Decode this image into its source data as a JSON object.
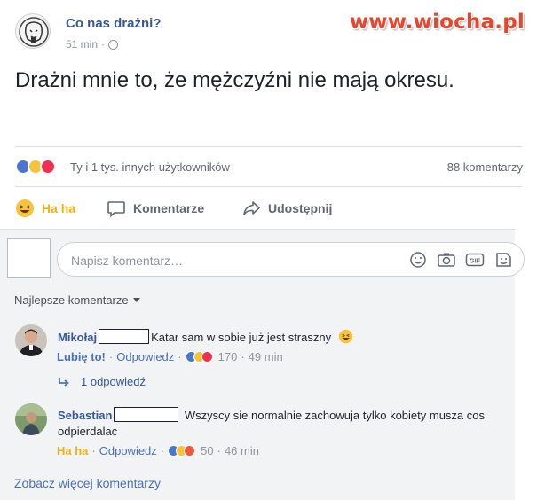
{
  "watermark": "www.wiocha.pl",
  "post": {
    "page_name": "Co nas drażni?",
    "time": "51 min",
    "separator": "·",
    "text": "Drażni mnie to, że mężczyźni nie mają okresu."
  },
  "reactions": {
    "summary": "Ty i 1 tys. innych użytkowników",
    "comments_count": "88 komentarzy"
  },
  "actions": {
    "haha": "Ha ha",
    "comment": "Komentarze",
    "share": "Udostępnij"
  },
  "composer": {
    "placeholder": "Napisz komentarz…",
    "gif_label": "GIF"
  },
  "sort": {
    "label": "Najlepsze komentarze"
  },
  "comments": [
    {
      "author": "Mikołaj",
      "text": "Katar sam w sobie już jest straszny",
      "reaction_link": "Lubię to!",
      "reply": "Odpowiedz",
      "reaction_count": "170",
      "time": "49 min",
      "replies": "1 odpowiedź"
    },
    {
      "author": "Sebastian",
      "text": "Wszyscy sie normalnie zachowuja tylko kobiety musza cos odpierdalac",
      "reaction_link": "Ha ha",
      "reply": "Odpowiedz",
      "reaction_count": "50",
      "time": "46 min"
    }
  ],
  "see_more": "Zobacz więcej komentarzy",
  "colors": {
    "link_blue": "#365899",
    "haha_yellow": "#f0b114",
    "watermark_red": "#e8452c"
  }
}
